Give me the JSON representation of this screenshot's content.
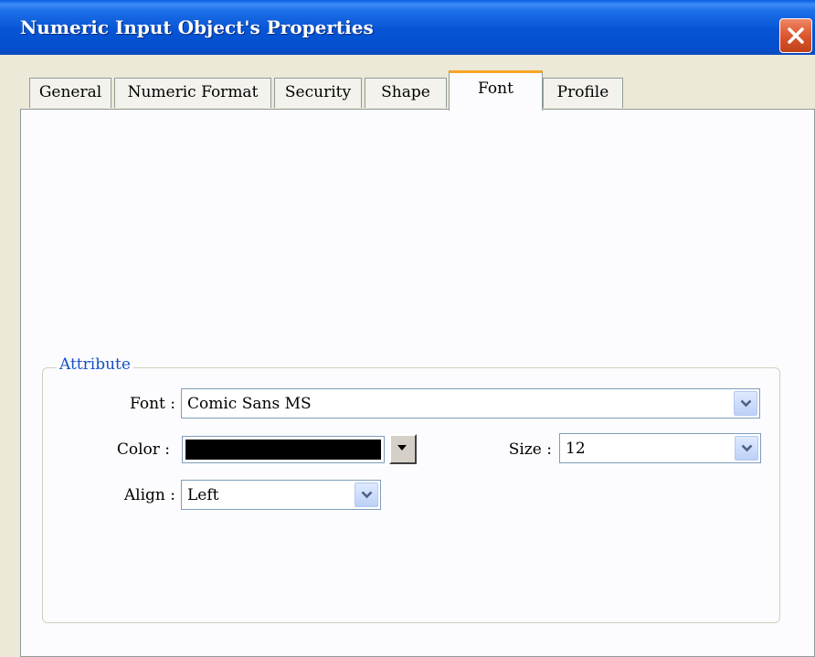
{
  "window": {
    "title": "Numeric Input Object's Properties"
  },
  "tabs": [
    {
      "label": "General",
      "active": false
    },
    {
      "label": "Numeric Format",
      "active": false
    },
    {
      "label": "Security",
      "active": false
    },
    {
      "label": "Shape",
      "active": false
    },
    {
      "label": "Font",
      "active": true
    },
    {
      "label": "Profile",
      "active": false
    }
  ],
  "attribute": {
    "legend": "Attribute",
    "font_label": "Font :",
    "font_value": "Comic Sans MS",
    "color_label": "Color :",
    "color_value": "#000000",
    "size_label": "Size :",
    "size_value": "12",
    "align_label": "Align :",
    "align_value": "Left"
  },
  "colors": {
    "titlebar": "#0654d4",
    "active_tab_accent": "#f6a623",
    "legend_text": "#1450c8",
    "close_button": "#d9532b"
  },
  "icons": {
    "close": "close-icon",
    "dropdown": "chevron-down-icon",
    "color_dropdown": "triangle-down-icon"
  }
}
